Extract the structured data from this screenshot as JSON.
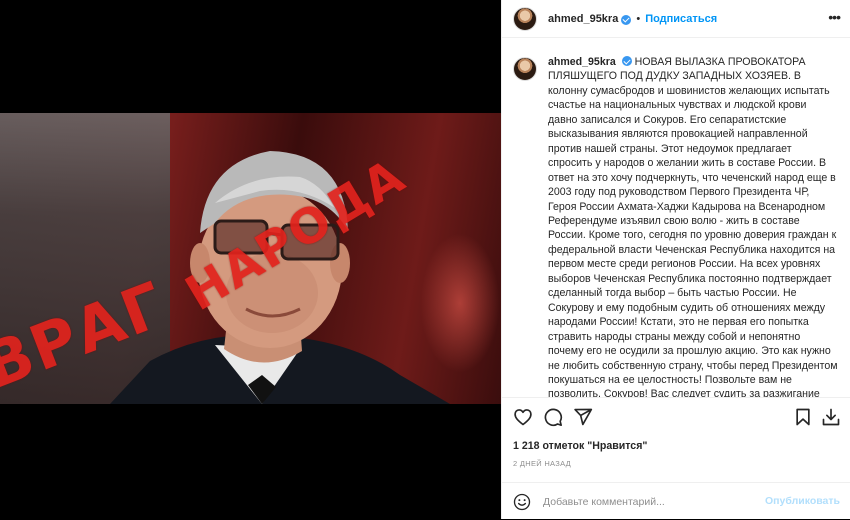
{
  "post": {
    "author": {
      "username": "ahmed_95kra",
      "verified": true,
      "follow_label": "Подписаться",
      "more_icon": "more-horizontal-icon"
    },
    "image": {
      "stamp_word_1": "ВРАГ",
      "stamp_word_2": "НАРОДА",
      "stamp_color": "#e2231d"
    },
    "caption": {
      "username": "ahmed_95kra",
      "text": "НОВАЯ ВЫЛАЗКА ПРОВОКАТОРА ПЛЯШУЩЕГО ПОД ДУДКУ ЗАПАДНЫХ ХОЗЯЕВ. В колонну сумасбродов и шовинистов желающих испытать счастье на национальных чувствах и людской крови давно записался и Сокуров. Его сепаратистские высказывания являются провокацией направленной против нашей страны. Этот недоумок предлагает спросить у народов о желании жить в составе России. В ответ на это хочу подчеркнуть, что чеченский народ еще в 2003 году под руководством Первого Президента ЧР, Героя России Ахмата-Хаджи Кадырова на Всенародном Референдуме изъявил свою волю - жить в составе России. Кроме того, сегодня по уровню доверия граждан к федеральной власти Чеченская Республика находится на первом месте среди регионов России. На всех уровнях выборов Чеченская Республика постоянно подтверждает сделанный тогда выбор – быть частью России. Не Сокурову и ему подобным судить об отношениях между народами России! Кстати, это не первая его попытка стравить народы страны между собой и непонятно почему его не осудили за прошлую акцию. Это как нужно не любить собственную страну, чтобы перед Президентом покушаться на ее целостность! Позвольте вам не позволить, Сокуров! Вас следует судить за разжигание межнациональной розни. Хочу обратить внимание"
    },
    "actions": {
      "icons": [
        "heart-icon",
        "comment-icon",
        "share-icon",
        "bookmark-icon",
        "download-icon"
      ],
      "likes": "1 218 отметок \"Нравится\"",
      "time": "2 ДНЕЙ НАЗАД"
    },
    "comment": {
      "placeholder": "Добавьте комментарий...",
      "publish_label": "Опубликовать",
      "emoji_icon": "emoji-icon"
    },
    "colors": {
      "link_blue": "#0095f6",
      "verified_blue": "#3897f0",
      "publish_disabled": "#b2dffc",
      "muted_text": "#8e8e8e"
    }
  }
}
